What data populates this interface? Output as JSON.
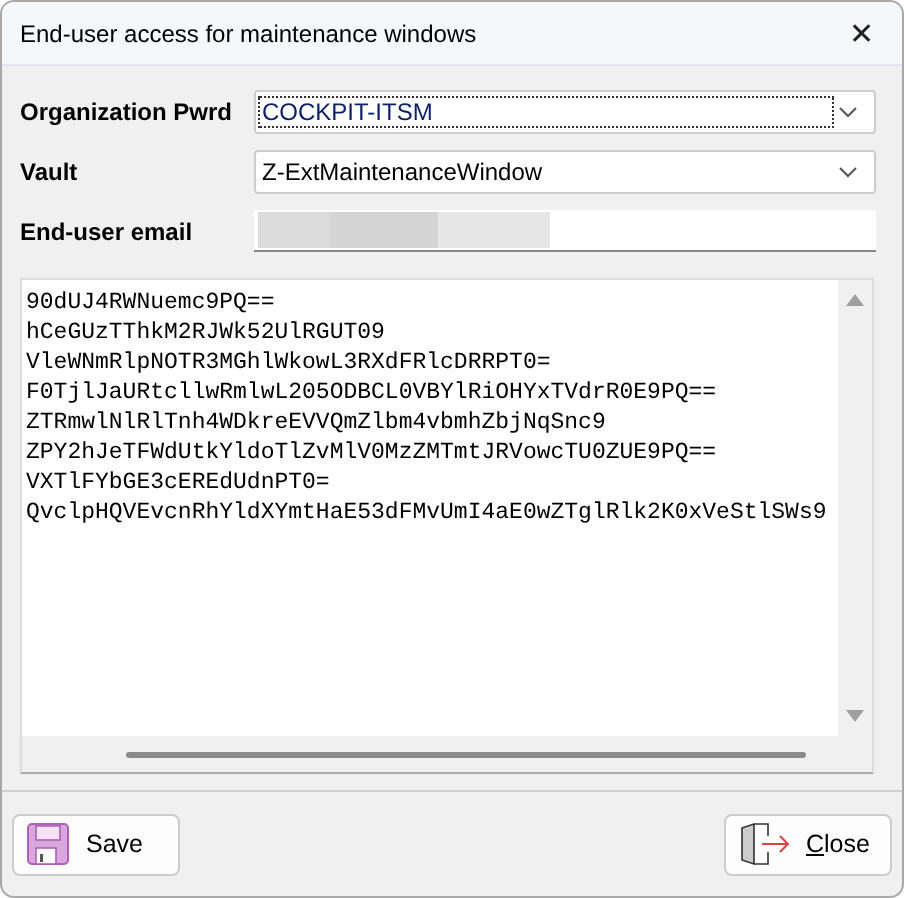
{
  "window": {
    "title": "End-user access for maintenance windows",
    "close_glyph": "✕"
  },
  "fields": [
    {
      "kind": "combo",
      "label": "Organization Pwrd",
      "value": "COCKPIT-ITSM",
      "focused": true
    },
    {
      "kind": "combo",
      "label": "Vault",
      "value": "Z-ExtMaintenanceWindow",
      "focused": false
    },
    {
      "kind": "text",
      "label": "End-user email",
      "redacted": true
    }
  ],
  "output_lines": [
    "90dUJ4RWNuemc9PQ==",
    "hCeGUzTThkM2RJWk52UlRGUT09",
    "VleWNmRlpNOTR3MGhlWkowL3RXdFRlcDRRPT0=",
    "F0TjlJaURtcllwRmlwL205ODBCL0VBYlRiOHYxTVdrR0E9PQ==",
    "ZTRmwlNlRlTnh4WDkreEVVQmZlbm4vbmhZbjNqSnc9",
    "ZPY2hJeTFWdUtkYldoTlZvMlV0MzZMTmtJRVowcTU0ZUE9PQ==",
    "VXTlFYbGE3cEREdUdnPT0=",
    "QvclpHQVEvcnRhYldXYmtHaE53dFMvUmI4aE0wZTglRlk2K0xVeStlSWs9"
  ],
  "buttons": [
    {
      "kind": "save",
      "label": "Save"
    },
    {
      "kind": "close",
      "label": "Close",
      "first_letter_underlined": true
    }
  ]
}
